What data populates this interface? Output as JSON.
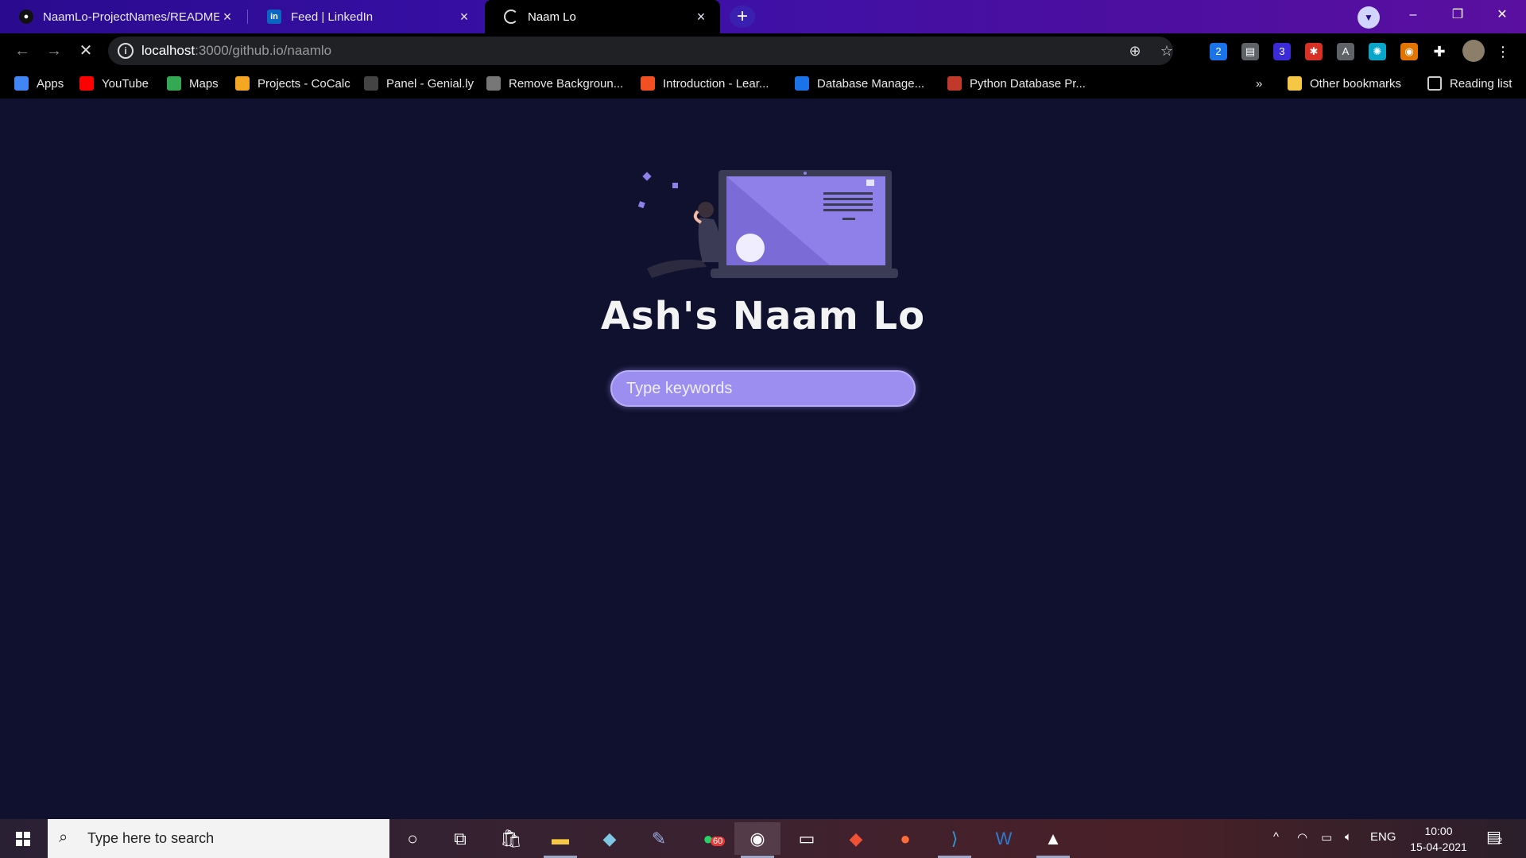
{
  "browser": {
    "tabs": [
      {
        "title": "NaamLo-ProjectNames/README",
        "icon": "github-icon",
        "active": false
      },
      {
        "title": "Feed | LinkedIn",
        "icon": "linkedin-icon",
        "active": false
      },
      {
        "title": "Naam Lo",
        "icon": "spinner-icon",
        "active": true
      }
    ],
    "url_host": "localhost",
    "url_rest": ":3000/github.io/naamlo",
    "extensions": [
      {
        "icon": "ext-2-icon",
        "text": "2",
        "color": "#1a73e8"
      },
      {
        "icon": "ext-printer-icon",
        "text": "▤",
        "color": "#5f6368"
      },
      {
        "icon": "ext-graduation-icon",
        "text": "3",
        "color": "#3b2bd6"
      },
      {
        "icon": "ext-red-icon",
        "text": "✱",
        "color": "#d93025"
      },
      {
        "icon": "ext-a-icon",
        "text": "A",
        "color": "#5f6368"
      },
      {
        "icon": "ext-cyan-icon",
        "text": "✺",
        "color": "#0aa6c9"
      },
      {
        "icon": "ext-circle-icon",
        "text": "◉",
        "color": "#e37400"
      }
    ],
    "bookmarks": [
      {
        "label": "Apps",
        "icon": "apps-grid-icon",
        "color": "#4285f4"
      },
      {
        "label": "YouTube",
        "icon": "youtube-icon",
        "color": "#ff0000"
      },
      {
        "label": "Maps",
        "icon": "maps-icon",
        "color": "#34a853"
      },
      {
        "label": "Projects - CoCalc",
        "icon": "cocalc-icon",
        "color": "#f5a623"
      },
      {
        "label": "Panel - Genial.ly",
        "icon": "genially-icon",
        "color": "#444444"
      },
      {
        "label": "Remove Backgroun...",
        "icon": "removebg-icon",
        "color": "#777777"
      },
      {
        "label": "Introduction - Lear...",
        "icon": "microsoft-icon",
        "color": "#f25022"
      },
      {
        "label": "Database Manage...",
        "icon": "infinity-icon",
        "color": "#1a73e8"
      },
      {
        "label": "Python Database Pr...",
        "icon": "python-db-icon",
        "color": "#c0392b"
      }
    ],
    "other_bookmarks": "Other bookmarks",
    "reading_list": "Reading list",
    "overflow": "»"
  },
  "page": {
    "title": "Ash's Naam Lo",
    "search_placeholder": "Type keywords"
  },
  "taskbar": {
    "search_placeholder": "Type here to search",
    "whatsapp_badge": "60",
    "lang": "ENG",
    "time": "10:00",
    "date": "15-04-2021",
    "notification_count": "2"
  }
}
